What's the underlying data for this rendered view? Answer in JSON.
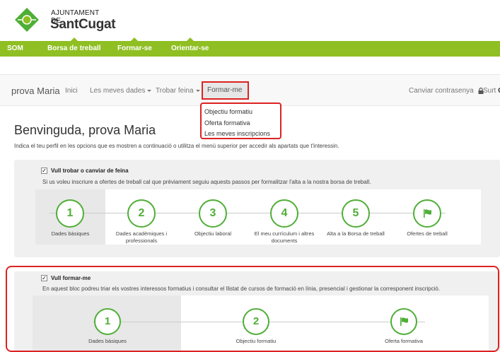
{
  "logo": {
    "line1": "AJUNTAMENT DE",
    "line2": "SantCugat"
  },
  "greenbar": {
    "items": [
      "SOM",
      "Borsa de treball",
      "Formar-se",
      "Orientar-se"
    ]
  },
  "usernav": {
    "brand": "prova Maria",
    "items": [
      "Inici",
      "Les meves dades",
      "Trobar feina",
      "Formar-me"
    ],
    "change_password": "Canviar contrasenya",
    "logout": "Surt"
  },
  "dropdown": {
    "items": [
      "Objectiu formatiu",
      "Oferta formativa",
      "Les meves inscripcions"
    ]
  },
  "welcome": {
    "title": "Benvinguda, prova Maria",
    "intro": "Indica el teu perfil en les opcions que es mostren a continuació o utilitza el menú superior per accedir als apartats que t'interessin."
  },
  "panel1": {
    "title": "Vull trobar o canviar de feina",
    "desc": "Si us voleu inscriure a ofertes de treball cal que préviament seguiu aquests passos per formalitzar l'alta a la nostra borsa de treball.",
    "steps": [
      {
        "num": "1",
        "label": "Dades bàsiques"
      },
      {
        "num": "2",
        "label": "Dades acadèmiques i professionals"
      },
      {
        "num": "3",
        "label": "Objectiu laboral"
      },
      {
        "num": "4",
        "label": "El meu currículum i altres documents"
      },
      {
        "num": "5",
        "label": "Alta a la Borsa de treball"
      },
      {
        "num": "",
        "label": "Ofertes de treball"
      }
    ]
  },
  "panel2": {
    "title": "Vull formar-me",
    "desc": "En aquest bloc podreu triar els vostres interessos formatius i consultar el llistat de cursos de formació en línia, presencial i gestionar la corresponent inscripció.",
    "steps": [
      {
        "num": "1",
        "label": "Dades bàsiques"
      },
      {
        "num": "2",
        "label": "Objectiu formatiu"
      },
      {
        "num": "",
        "label": "Oferta formativa"
      }
    ]
  },
  "colors": {
    "green": "#8fbf22",
    "step_green": "#4fae36",
    "highlight_red": "#dd2222"
  }
}
